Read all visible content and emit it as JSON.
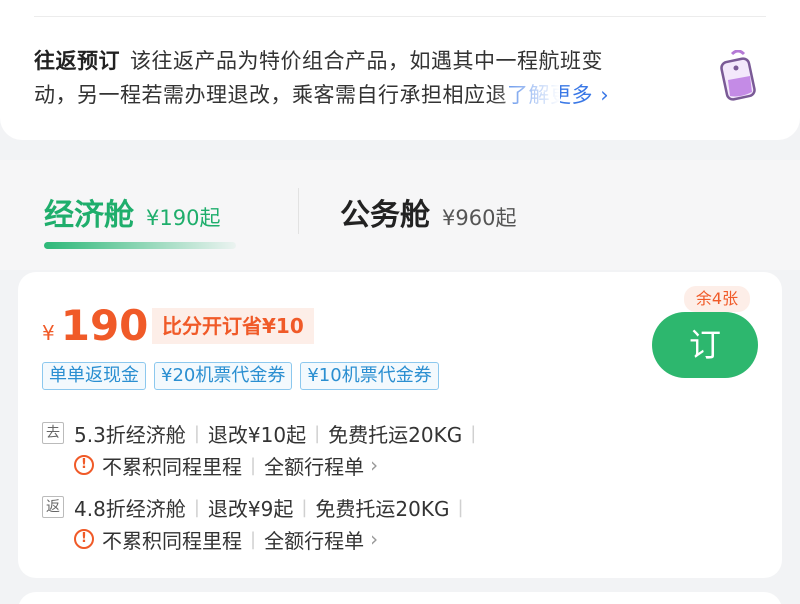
{
  "notice": {
    "title": "往返预订",
    "line1": "该往返产品为特价组合产品，如遇其中一程航班变",
    "line2": "动，另一程若需办理退改，乘客需自行承担相应退",
    "more_label": "了解更多",
    "chevron": "›"
  },
  "tabs": [
    {
      "name": "经济舱",
      "price": "¥190起"
    },
    {
      "name": "公务舱",
      "price": "¥960起"
    }
  ],
  "fare": {
    "currency": "¥",
    "price": "190",
    "save_badge": "比分开订省¥10",
    "remaining": "余4张",
    "book_label": "订",
    "benefits": [
      "单单返现金",
      "¥20机票代金券",
      "¥10机票代金券"
    ],
    "segments": [
      {
        "tag": "去",
        "cabin": "5.3折经济舱",
        "change": "退改¥10起",
        "baggage": "免费托运20KG",
        "miles": "不累积同程里程",
        "itinerary": "全额行程单"
      },
      {
        "tag": "返",
        "cabin": "4.8折经济舱",
        "change": "退改¥9起",
        "baggage": "免费托运20KG",
        "miles": "不累积同程里程",
        "itinerary": "全额行程单"
      }
    ]
  },
  "colors": {
    "accent_green": "#2db76e",
    "price_orange": "#f05a28",
    "link_blue": "#3a78e6"
  },
  "icons": {
    "notice": "luggage-tag-icon",
    "warning": "warning-circle-icon",
    "chevron": "chevron-right-icon"
  }
}
